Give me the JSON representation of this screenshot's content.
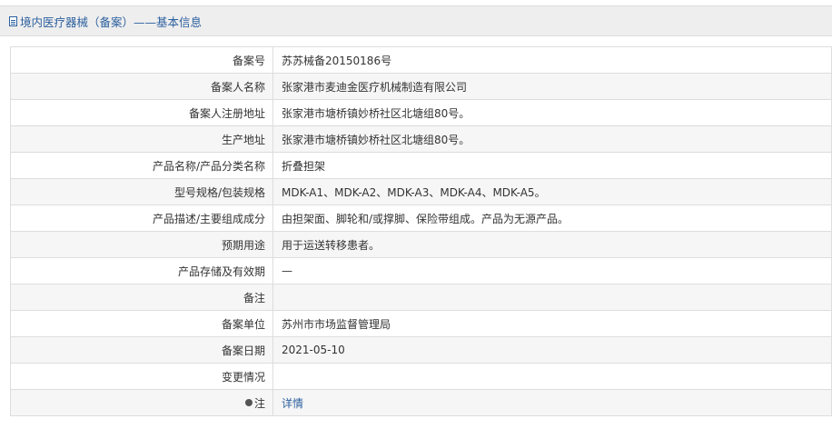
{
  "header": {
    "title": "境内医疗器械（备案）——基本信息",
    "icon": "document-icon"
  },
  "rows": [
    {
      "label": "备案号",
      "value": "苏苏械备20150186号"
    },
    {
      "label": "备案人名称",
      "value": "张家港市麦迪金医疗机械制造有限公司"
    },
    {
      "label": "备案人注册地址",
      "value": "张家港市塘桥镇妙桥社区北塘组80号。"
    },
    {
      "label": "生产地址",
      "value": "张家港市塘桥镇妙桥社区北塘组80号。"
    },
    {
      "label": "产品名称/产品分类名称",
      "value": "折叠担架"
    },
    {
      "label": "型号规格/包装规格",
      "value": "MDK-A1、MDK-A2、MDK-A3、MDK-A4、MDK-A5。"
    },
    {
      "label": "产品描述/主要组成成分",
      "value": "由担架面、脚轮和/或撑脚、保险带组成。产品为无源产品。"
    },
    {
      "label": "预期用途",
      "value": "用于运送转移患者。"
    },
    {
      "label": "产品存储及有效期",
      "value": "—"
    },
    {
      "label": "备注",
      "value": ""
    },
    {
      "label": "备案单位",
      "value": "苏州市市场监督管理局"
    },
    {
      "label": "备案日期",
      "value": "2021-05-10"
    },
    {
      "label": "变更情况",
      "value": ""
    }
  ],
  "note": {
    "label": "注",
    "icon": "note-icon",
    "link_text": "详情"
  },
  "colors": {
    "link": "#2b5f9e",
    "border": "#dddddd",
    "stripe": "#f6f6f6"
  }
}
